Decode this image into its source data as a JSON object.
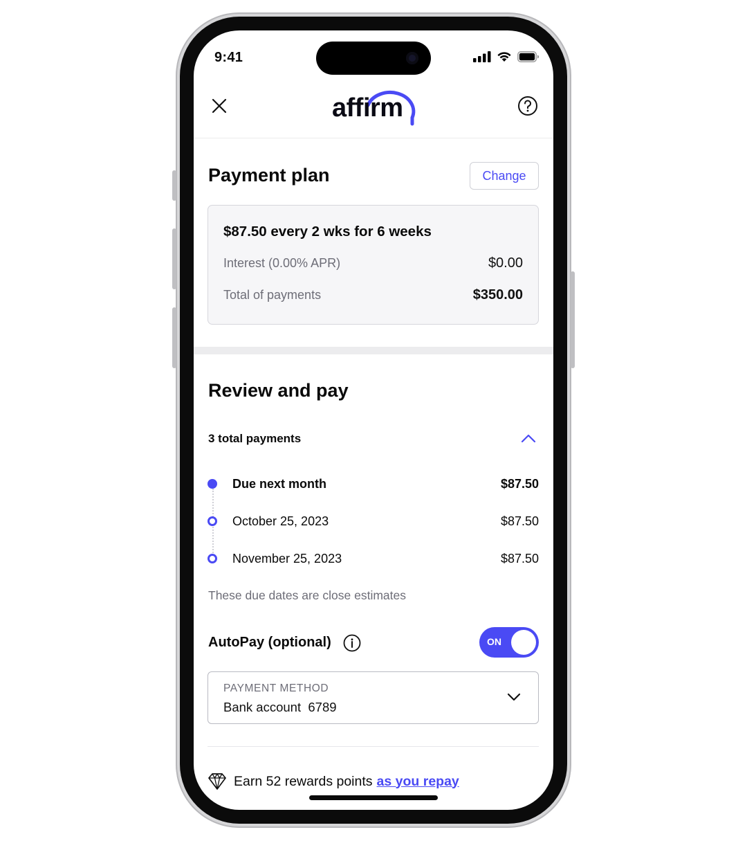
{
  "status_bar": {
    "time": "9:41"
  },
  "header": {
    "logo_text": "affirm",
    "close_icon": "close-icon",
    "help_icon": "question-circle-icon"
  },
  "payment_plan": {
    "title": "Payment plan",
    "change_label": "Change",
    "headline": "$87.50 every 2 wks for 6 weeks",
    "rows": [
      {
        "label": "Interest (0.00% APR)",
        "value": "$0.00"
      },
      {
        "label": "Total of payments",
        "value": "$350.00"
      }
    ]
  },
  "review": {
    "title": "Review and pay",
    "payments_count_label": "3 total payments",
    "payments": [
      {
        "label": "Due next month",
        "amount": "$87.50"
      },
      {
        "label": "October 25, 2023",
        "amount": "$87.50"
      },
      {
        "label": "November 25, 2023",
        "amount": "$87.50"
      }
    ],
    "note": "These due dates are close estimates"
  },
  "autopay": {
    "label": "AutoPay (optional)",
    "toggle_state": "ON"
  },
  "payment_method": {
    "caption": "PAYMENT METHOD",
    "value": "Bank account  6789"
  },
  "rewards": {
    "text": "Earn 52 rewards points",
    "link_text": "as you repay",
    "icon": "diamond-icon"
  },
  "colors": {
    "accent": "#4a4af4",
    "text": "#0a0a0a",
    "muted": "#6d6d77",
    "card_bg": "#f6f6f8"
  }
}
